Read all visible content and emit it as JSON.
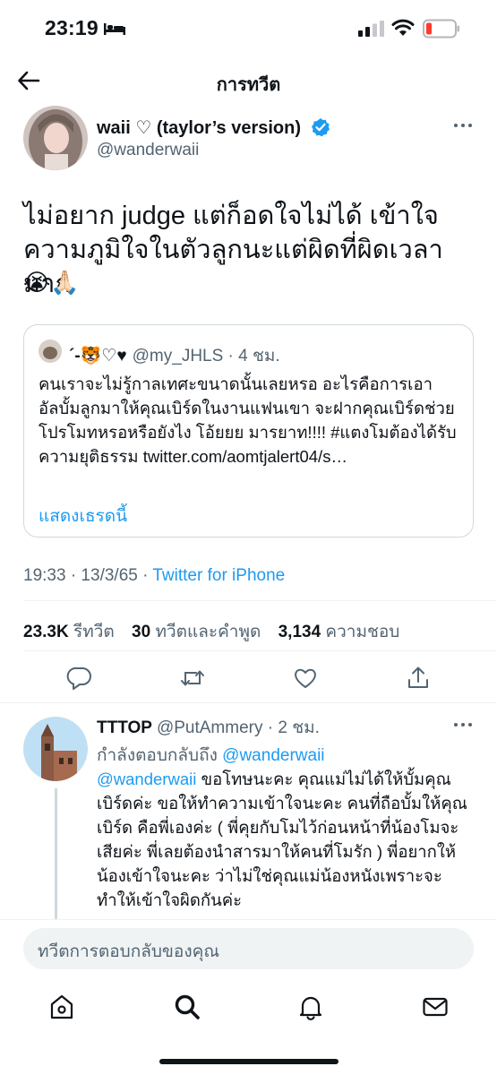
{
  "status_bar": {
    "time": "23:19"
  },
  "header": {
    "title": "การทวีต"
  },
  "tweet": {
    "display_name": "waii ♡ (taylor’s version)",
    "handle": "@wanderwaii",
    "text": "ไม่อยาก judge แต่ก็อดใจไม่ได้ เข้าใจความภูมิใจในตัวลูกนะแต่ผิดที่ผิดเวลามาก",
    "emojis": "😭🙏🏻",
    "quote": {
      "name": "´-🐯♡♥",
      "handle_time": "@my_JHLS · 4 ชม.",
      "text": "คนเราจะไม่รู้กาลเทศะขนาดนั้นเลยหรอ อะไรคือการเอาอัลบั้มลูกมาให้คุณเบิร์ดในงานแฟนเขา จะฝากคุณเบิร์ดช่วยโปรโมทหรอหรือยังไง โอ้ยยย มารยาท!!!! #แตงโมต้องได้รับความยุติธรรม twitter.com/aomtjalert04/s…",
      "show_thread": "แสดงเธรดนี้"
    },
    "time_date": "19:33 · 13/3/65 · ",
    "source": "Twitter for iPhone",
    "stats": {
      "retweets_count": "23.3K",
      "retweets_label": "รีทวีต",
      "quotes_count": "30",
      "quotes_label": "ทวีตและคำพูด",
      "likes_count": "3,134",
      "likes_label": "ความชอบ"
    }
  },
  "reply": {
    "display_name": "TTTOP",
    "handle_time": "@PutAmmery · 2 ชม.",
    "replying_prefix": "กำลังตอบกลับถึง ",
    "replying_mention": "@wanderwaii",
    "mention": "@wanderwaii",
    "text": " ขอโทษนะคะ คุณแม่ไม่ได้ให้บั้มคุณเบิร์ดค่ะ ขอให้ทำความเข้าใจนะคะ คนที่ถือบั้มให้คุณเบิร์ด คือพี่เองค่ะ ( พี่คุยกับโมไว้ก่อนหน้าที่น้องโมจะเสียค่ะ พี่เลยต้องนำสารมาให้คนที่โมรัก ) พี่อยากให้น้องเข้าใจนะคะ ว่าไม่ใช่คุณแม่น้องหนังเพราะจะทำให้เข้าใจผิดกันค่ะ"
  },
  "compose": {
    "placeholder": "ทวีตการตอบกลับของคุณ"
  },
  "icons": [
    "bed-icon",
    "signal-icon",
    "wifi-icon",
    "battery-icon",
    "back-arrow-icon",
    "verified-badge-icon",
    "more-icon",
    "reply-icon",
    "retweet-icon",
    "like-icon",
    "share-icon",
    "home-icon",
    "search-icon",
    "notifications-icon",
    "messages-icon"
  ],
  "colors": {
    "accent": "#1d9bf0",
    "secondary_text": "#536471",
    "battery_low": "#ff3b30"
  }
}
